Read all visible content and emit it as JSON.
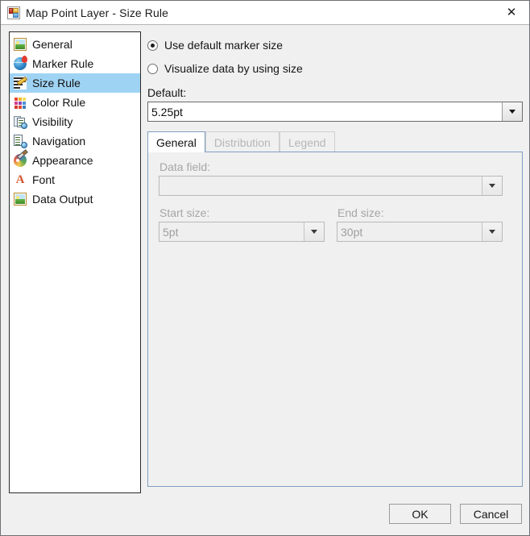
{
  "window": {
    "title": "Map Point Layer - Size Rule",
    "icon": "form-designer-icon",
    "close_label": "✕"
  },
  "sidebar": {
    "items": [
      {
        "label": "General",
        "icon": "picture-icon",
        "selected": false
      },
      {
        "label": "Marker Rule",
        "icon": "globe-pin-icon",
        "selected": false
      },
      {
        "label": "Size Rule",
        "icon": "size-rule-icon",
        "selected": true
      },
      {
        "label": "Color Rule",
        "icon": "color-grid-icon",
        "selected": false
      },
      {
        "label": "Visibility",
        "icon": "visibility-icon",
        "selected": false
      },
      {
        "label": "Navigation",
        "icon": "navigation-icon",
        "selected": false
      },
      {
        "label": "Appearance",
        "icon": "palette-icon",
        "selected": false
      },
      {
        "label": "Font",
        "icon": "font-icon",
        "selected": false
      },
      {
        "label": "Data Output",
        "icon": "picture-icon",
        "selected": false
      }
    ]
  },
  "main": {
    "radios": [
      {
        "label": "Use default marker size",
        "checked": true
      },
      {
        "label": "Visualize data by using size",
        "checked": false
      }
    ],
    "default": {
      "label": "Default:",
      "value": "5.25pt"
    },
    "tabs": [
      {
        "label": "General",
        "state": "active"
      },
      {
        "label": "Distribution",
        "state": "disabled"
      },
      {
        "label": "Legend",
        "state": "disabled"
      }
    ],
    "general_tab": {
      "data_field": {
        "label": "Data field:",
        "value": "",
        "enabled": false
      },
      "start_size": {
        "label": "Start size:",
        "value": "5pt",
        "enabled": false
      },
      "end_size": {
        "label": "End size:",
        "value": "30pt",
        "enabled": false
      }
    }
  },
  "footer": {
    "ok_label": "OK",
    "cancel_label": "Cancel"
  },
  "colors": {
    "selection": "#9fd3f3",
    "dialog_bg": "#f0f0f0",
    "tab_border": "#7f9fc0",
    "disabled_text": "#a6a6a6"
  }
}
